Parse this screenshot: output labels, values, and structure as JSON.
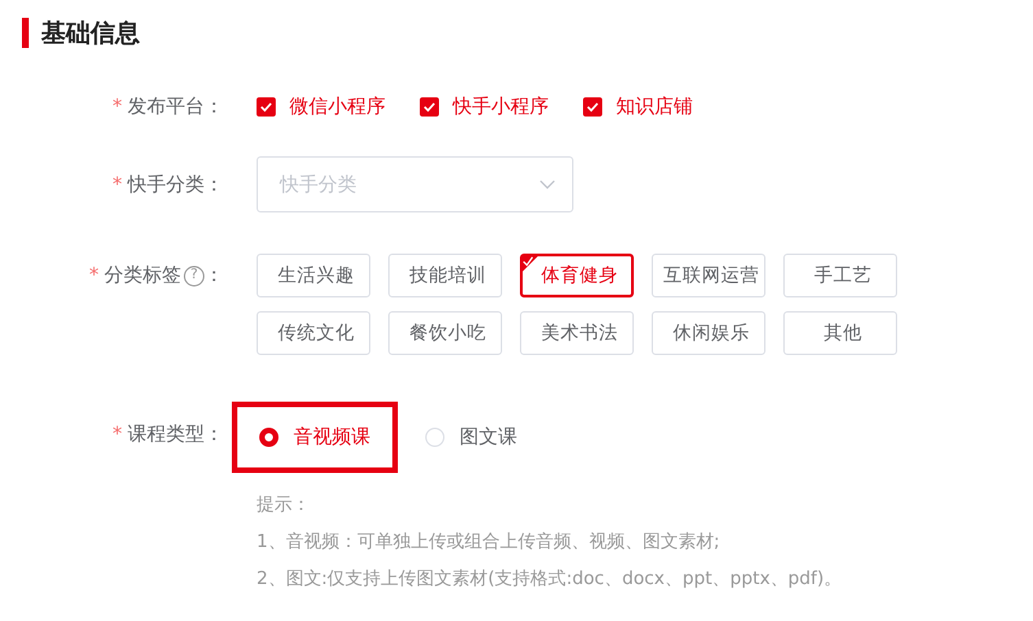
{
  "section_title": "基础信息",
  "platform": {
    "label": "发布平台：",
    "required_mark": "*",
    "options": [
      {
        "label": "微信小程序",
        "checked": true
      },
      {
        "label": "快手小程序",
        "checked": true
      },
      {
        "label": "知识店铺",
        "checked": true
      }
    ]
  },
  "category": {
    "label": "快手分类：",
    "required_mark": "*",
    "placeholder": "快手分类"
  },
  "tags": {
    "label": "分类标签",
    "colon": "：",
    "required_mark": "*",
    "help_icon": "?",
    "items": [
      {
        "label": "生活兴趣",
        "selected": false
      },
      {
        "label": "技能培训",
        "selected": false
      },
      {
        "label": "体育健身",
        "selected": true
      },
      {
        "label": "互联网运营",
        "selected": false
      },
      {
        "label": "手工艺",
        "selected": false
      },
      {
        "label": "传统文化",
        "selected": false
      },
      {
        "label": "餐饮小吃",
        "selected": false
      },
      {
        "label": "美术书法",
        "selected": false
      },
      {
        "label": "休闲娱乐",
        "selected": false
      },
      {
        "label": "其他",
        "selected": false
      }
    ]
  },
  "course_type": {
    "label": "课程类型：",
    "required_mark": "*",
    "options": [
      {
        "label": "音视频课",
        "selected": true,
        "highlighted": true
      },
      {
        "label": "图文课",
        "selected": false,
        "highlighted": false
      }
    ]
  },
  "hints": [
    "提示：",
    "1、音视频：可单独上传或组合上传音频、视频、图文素材;",
    "2、图文:仅支持上传图文素材(支持格式:doc、docx、ppt、pptx、pdf)。"
  ]
}
